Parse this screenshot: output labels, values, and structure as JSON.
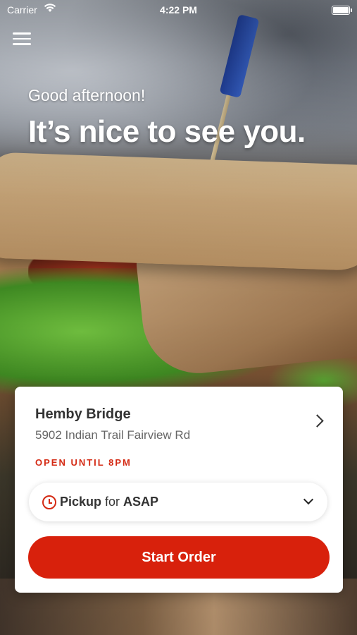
{
  "status_bar": {
    "carrier": "Carrier",
    "time": "4:22 PM",
    "wifi_icon": "wifi-icon",
    "battery_icon": "battery-icon"
  },
  "header": {
    "menu_icon": "hamburger-menu-icon",
    "greeting": "Good afternoon!",
    "headline": "It’s nice to see you."
  },
  "location": {
    "name": "Hemby Bridge",
    "address": "5902 Indian Trail Fairview Rd",
    "hours": "OPEN UNTIL 8PM"
  },
  "order_type": {
    "mode": "Pickup",
    "connector": " for ",
    "time": "ASAP"
  },
  "actions": {
    "start_order": "Start Order"
  },
  "colors": {
    "accent": "#d8210c",
    "accent_text": "#d42a14"
  }
}
